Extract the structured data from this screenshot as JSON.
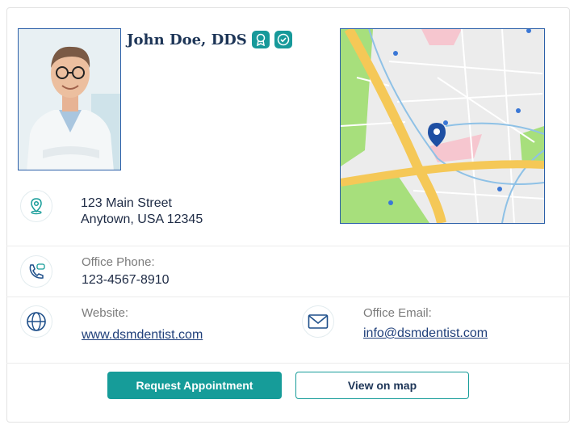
{
  "profile": {
    "name": "John Doe, DDS",
    "address_line1": "123 Main Street",
    "address_line2": "Anytown, USA 12345"
  },
  "contact": {
    "phone_label": "Office Phone:",
    "phone_value": "123-4567-8910",
    "website_label": "Website:",
    "website_value": "www.dsmdentist.com",
    "email_label": "Office Email:",
    "email_value": "info@dsmdentist.com"
  },
  "actions": {
    "request_label": "Request Appointment",
    "map_label": "View on map"
  },
  "colors": {
    "accent": "#169c99",
    "name": "#1d3557",
    "border_blue": "#2b5fa8"
  },
  "icons": {
    "award": "award-badge-icon",
    "verified": "verified-badge-icon",
    "location": "location-pin-icon",
    "phone": "phone-chat-icon",
    "web": "globe-icon",
    "email": "envelope-icon",
    "map_marker": "map-marker-icon"
  }
}
